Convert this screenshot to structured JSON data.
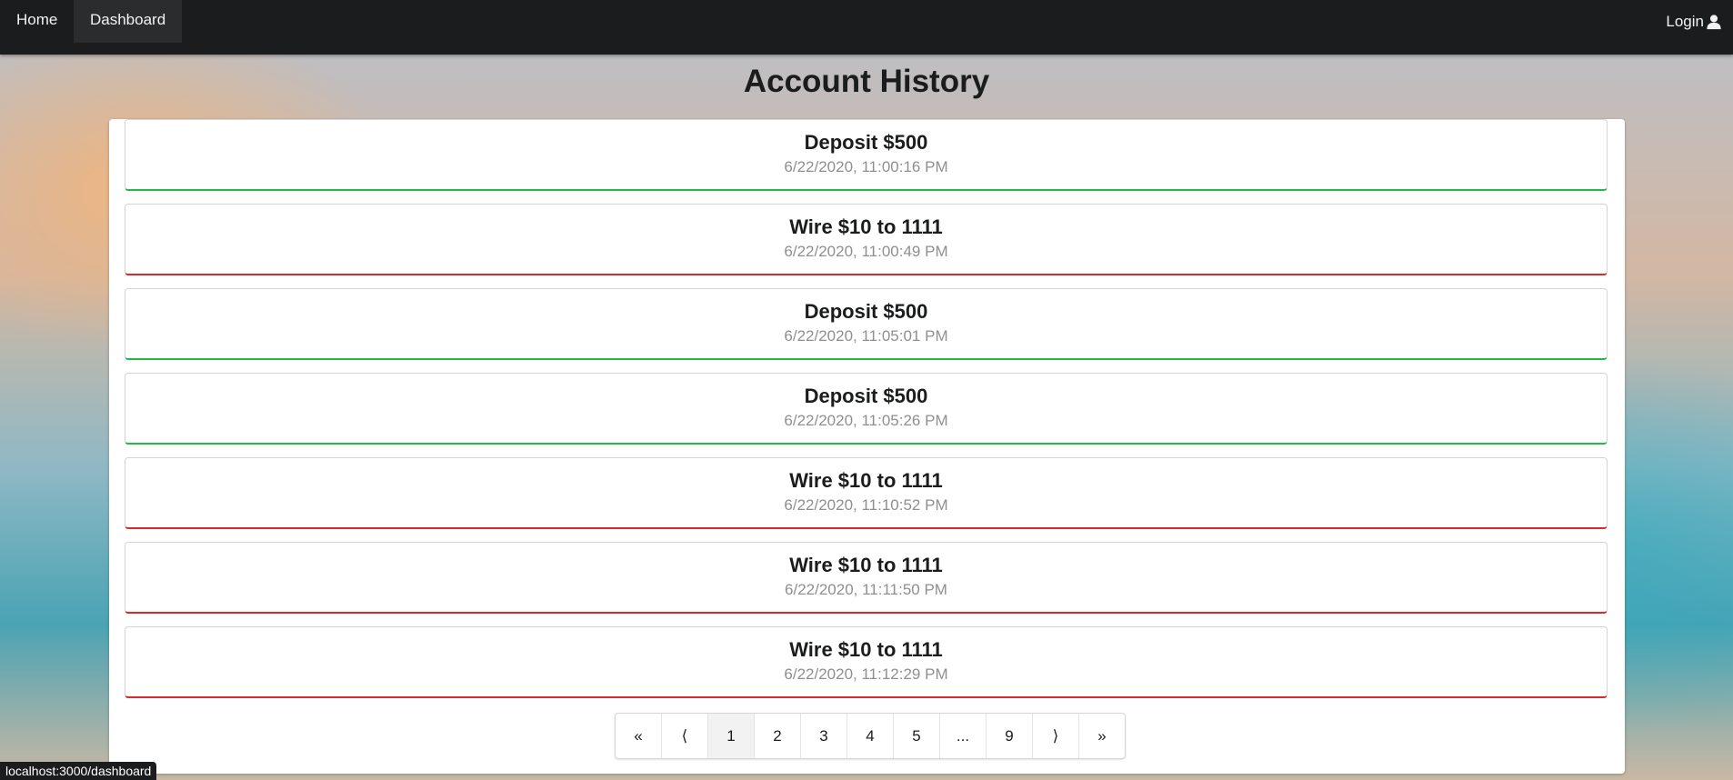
{
  "nav": {
    "home": "Home",
    "dashboard": "Dashboard",
    "login": "Login",
    "login_icon": "user-icon"
  },
  "page": {
    "title": "Account History"
  },
  "entries": [
    {
      "title": "Deposit $500",
      "time": "6/22/2020, 11:00:16 PM",
      "type": "deposit",
      "color": "#21ba45"
    },
    {
      "title": "Wire $10 to 1111",
      "time": "6/22/2020, 11:00:49 PM",
      "type": "wire",
      "color": "#db2828"
    },
    {
      "title": "Deposit $500",
      "time": "6/22/2020, 11:05:01 PM",
      "type": "deposit",
      "color": "#21ba45"
    },
    {
      "title": "Deposit $500",
      "time": "6/22/2020, 11:05:26 PM",
      "type": "deposit",
      "color": "#21ba45"
    },
    {
      "title": "Wire $10 to 1111",
      "time": "6/22/2020, 11:10:52 PM",
      "type": "wire",
      "color": "#db2828"
    },
    {
      "title": "Wire $10 to 1111",
      "time": "6/22/2020, 11:11:50 PM",
      "type": "wire",
      "color": "#db2828"
    },
    {
      "title": "Wire $10 to 1111",
      "time": "6/22/2020, 11:12:29 PM",
      "type": "wire",
      "color": "#db2828"
    }
  ],
  "pagination": {
    "first": "«",
    "prev": "⟨",
    "pages": [
      "1",
      "2",
      "3",
      "4",
      "5",
      "...",
      "9"
    ],
    "next": "⟩",
    "last": "»",
    "active": "1"
  },
  "status_bar": {
    "url": "localhost:3000/dashboard"
  }
}
